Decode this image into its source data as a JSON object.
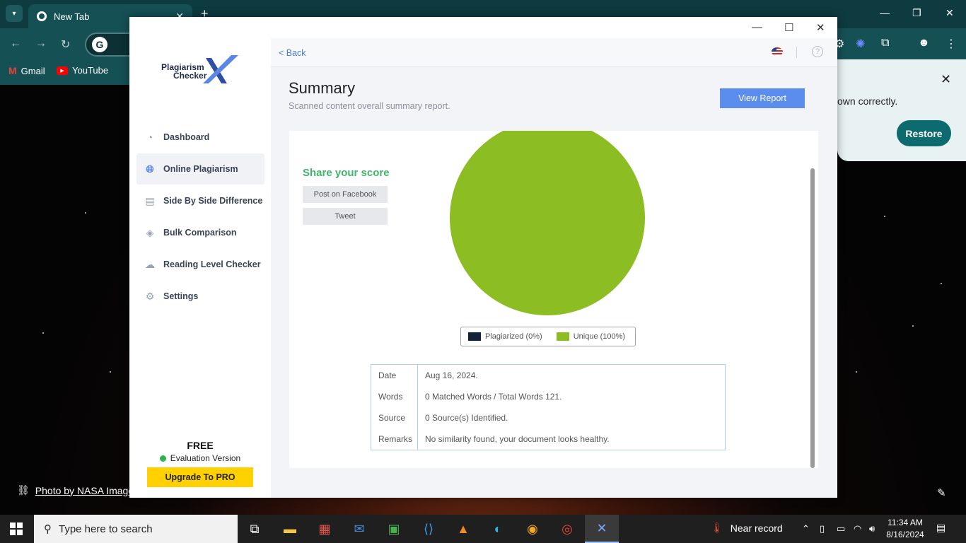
{
  "browser": {
    "tab_title": "New Tab",
    "bookmarks": [
      {
        "label": "Gmail"
      },
      {
        "label": "YouTube"
      }
    ],
    "restore_popup": {
      "message": "own correctly.",
      "restore_label": "Restore"
    }
  },
  "desktop": {
    "photo_credit": "Photo by NASA Image"
  },
  "app": {
    "logo": {
      "line1": "Plagiarism",
      "line2": "Checker",
      "mark": "X"
    },
    "nav": [
      {
        "label": "Dashboard",
        "icon": "gauge-icon",
        "active": false
      },
      {
        "label": "Online Plagiarism",
        "icon": "globe-icon",
        "active": true
      },
      {
        "label": "Side By Side Difference",
        "icon": "document-icon",
        "active": false
      },
      {
        "label": "Bulk Comparison",
        "icon": "layers-icon",
        "active": false
      },
      {
        "label": "Reading Level Checker",
        "icon": "cloud-icon",
        "active": false
      },
      {
        "label": "Settings",
        "icon": "gear-icon",
        "active": false
      }
    ],
    "plan": {
      "title": "FREE",
      "status": "Evaluation Version",
      "upgrade_label": "Upgrade To PRO"
    },
    "topbar": {
      "back_label": "< Back"
    },
    "summary": {
      "title": "Summary",
      "subtitle": "Scanned content overall summary report.",
      "view_report_label": "View Report"
    },
    "share": {
      "title": "Share your score",
      "facebook_label": "Post on Facebook",
      "tweet_label": "Tweet"
    },
    "results": {
      "rows": [
        {
          "key": "Date",
          "value": "Aug 16, 2024."
        },
        {
          "key": "Words",
          "value": "0 Matched Words / Total Words 121."
        },
        {
          "key": "Source",
          "value": "0 Source(s) Identified."
        },
        {
          "key": "Remarks",
          "value": "No similarity found, your document looks healthy."
        }
      ]
    }
  },
  "chart_data": {
    "type": "pie",
    "slices": [
      {
        "label": "Plagiarized (0%)",
        "value": 0,
        "color": "#13223a"
      },
      {
        "label": "Unique (100%)",
        "value": 100,
        "color": "#8cbd23"
      }
    ]
  },
  "taskbar": {
    "search_placeholder": "Type here to search",
    "weather": "Near record",
    "time": "11:34 AM",
    "date": "8/16/2024"
  }
}
